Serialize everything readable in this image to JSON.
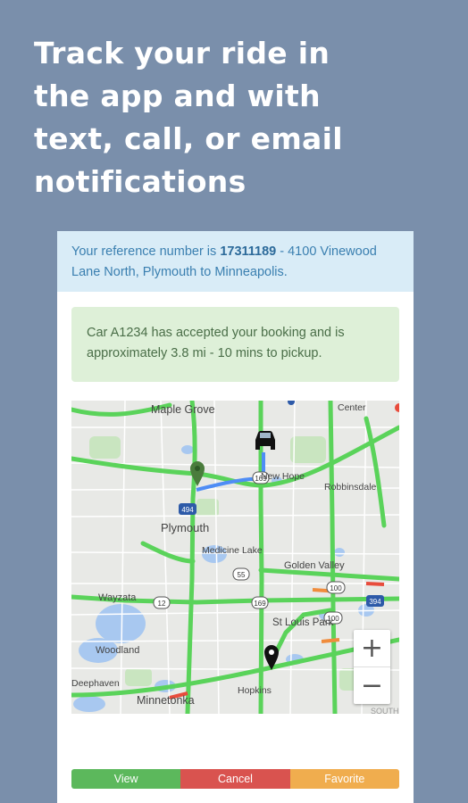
{
  "headline": {
    "line1": "Track your ride in",
    "line2": "the app and with",
    "line3": "text, call, or email",
    "line4": "notifications"
  },
  "reference": {
    "prefix": "Your reference number is ",
    "number": "17311189",
    "suffix": " - 4100 Vinewood Lane North, Plymouth to Minneapolis."
  },
  "booking_alert": "Car A1234 has accepted your booking and is approximately 3.8 mi - 10 mins to pickup.",
  "map": {
    "places": [
      {
        "name": "Maple Grove",
        "id": "place-maple-grove"
      },
      {
        "name": "Center",
        "id": "place-center"
      },
      {
        "name": "New Hope",
        "id": "place-new-hope"
      },
      {
        "name": "Robbinsdale",
        "id": "place-robbinsdale"
      },
      {
        "name": "Plymouth",
        "id": "place-plymouth"
      },
      {
        "name": "Medicine Lake",
        "id": "place-medicine-lake"
      },
      {
        "name": "Golden Valley",
        "id": "place-golden-valley"
      },
      {
        "name": "Wayzata",
        "id": "place-wayzata"
      },
      {
        "name": "St Louis Park",
        "id": "place-st-louis-park"
      },
      {
        "name": "Woodland",
        "id": "place-woodland"
      },
      {
        "name": "Deephaven",
        "id": "place-deephaven"
      },
      {
        "name": "Hopkins",
        "id": "place-hopkins"
      },
      {
        "name": "Minnetonka",
        "id": "place-minnetonka"
      },
      {
        "name": "SOUTH",
        "id": "place-south"
      }
    ],
    "shields": [
      "494",
      "169",
      "55",
      "12",
      "100",
      "394",
      "169",
      "100"
    ],
    "zoom_in": "+",
    "zoom_out": "−",
    "colors": {
      "traffic": "#5ad35a",
      "route": "#4f8df5",
      "marker_pickup": "#4a7c3c",
      "marker_drop": "#111111"
    }
  },
  "actions": {
    "view": "View",
    "cancel": "Cancel",
    "favorite": "Favorite"
  }
}
